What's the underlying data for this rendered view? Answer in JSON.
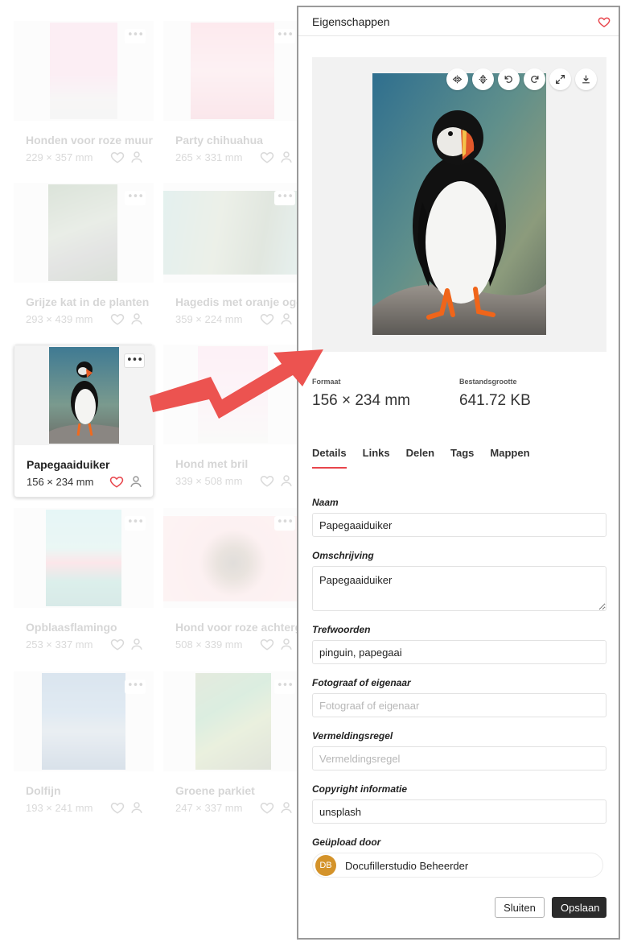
{
  "gallery": {
    "cards": [
      {
        "title": "Honden voor roze muur",
        "dims": "229 × 357 mm"
      },
      {
        "title": "Party chihuahua",
        "dims": "265 × 331 mm"
      },
      {
        "title": "Grijze kat in de planten",
        "dims": "293 × 439 mm"
      },
      {
        "title": "Hagedis met oranje ogen",
        "dims": "359 × 224 mm"
      },
      {
        "title": "Papegaaiduiker",
        "dims": "156 × 234 mm"
      },
      {
        "title": "Hond met bril",
        "dims": "339 × 508 mm"
      },
      {
        "title": "Opblaasflamingo",
        "dims": "253 × 337 mm"
      },
      {
        "title": "Hond voor roze achtergrond",
        "dims": "508 × 339 mm"
      },
      {
        "title": "Dolfijn",
        "dims": "193 × 241 mm"
      },
      {
        "title": "Groene parkiet",
        "dims": "247 × 337 mm"
      }
    ],
    "more_glyph": "•••"
  },
  "panel": {
    "title": "Eigenschappen",
    "format_label": "Formaat",
    "format_value": "156 × 234 mm",
    "size_label": "Bestandsgrootte",
    "size_value": "641.72 KB",
    "tabs": [
      "Details",
      "Links",
      "Delen",
      "Tags",
      "Mappen"
    ],
    "active_tab": "Details",
    "fields": {
      "name_label": "Naam",
      "name_value": "Papegaaiduiker",
      "description_label": "Omschrijving",
      "description_value": "Papegaaiduiker",
      "keywords_label": "Trefwoorden",
      "keywords_value": "pinguin, papegaai",
      "photographer_label": "Fotograaf of eigenaar",
      "photographer_placeholder": "Fotograaf of eigenaar",
      "credit_label": "Vermeldingsregel",
      "credit_placeholder": "Vermeldingsregel",
      "copyright_label": "Copyright informatie",
      "copyright_value": "unsplash",
      "uploaded_by_label": "Geüpload door",
      "uploader_initials": "DB",
      "uploader_name": "Docufillerstudio Beheerder"
    },
    "buttons": {
      "close": "Sluiten",
      "save": "Opslaan"
    }
  },
  "colors": {
    "accent": "#e8454c",
    "arrow": "#ec5350",
    "avatar": "#d4932a",
    "save_button": "#2b2b2b"
  }
}
